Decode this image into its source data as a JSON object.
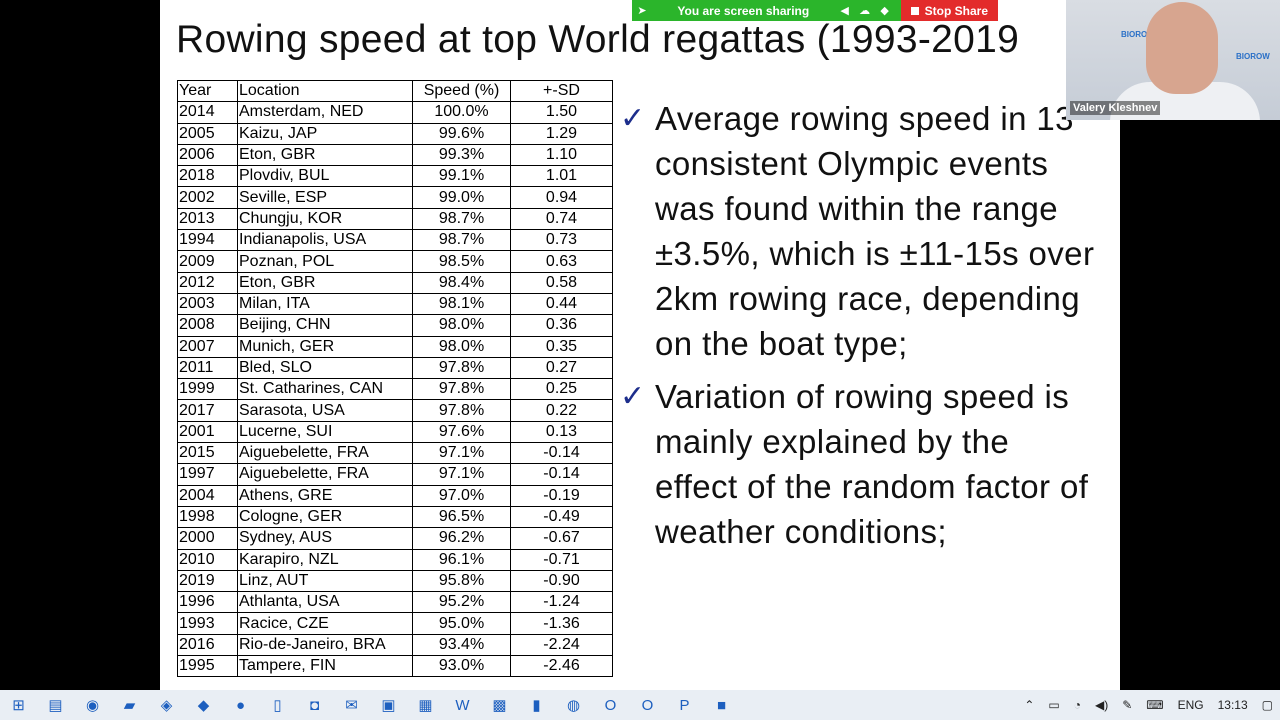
{
  "share_bar": {
    "status": "You are screen sharing",
    "stop_label": "Stop Share"
  },
  "slide": {
    "title": "Rowing speed at top World regattas (1993-2019",
    "table": {
      "headers": [
        "Year",
        "Location",
        "Speed (%)",
        "+-SD"
      ],
      "rows": [
        [
          "2014",
          "Amsterdam, NED",
          "100.0%",
          "1.50"
        ],
        [
          "2005",
          "Kaizu, JAP",
          "99.6%",
          "1.29"
        ],
        [
          "2006",
          "Eton, GBR",
          "99.3%",
          "1.10"
        ],
        [
          "2018",
          "Plovdiv, BUL",
          "99.1%",
          "1.01"
        ],
        [
          "2002",
          "Seville, ESP",
          "99.0%",
          "0.94"
        ],
        [
          "2013",
          "Chungju, KOR",
          "98.7%",
          "0.74"
        ],
        [
          "1994",
          "Indianapolis, USA",
          "98.7%",
          "0.73"
        ],
        [
          "2009",
          "Poznan, POL",
          "98.5%",
          "0.63"
        ],
        [
          "2012",
          "Eton, GBR",
          "98.4%",
          "0.58"
        ],
        [
          "2003",
          "Milan, ITA",
          "98.1%",
          "0.44"
        ],
        [
          "2008",
          "Beijing, CHN",
          "98.0%",
          "0.36"
        ],
        [
          "2007",
          "Munich, GER",
          "98.0%",
          "0.35"
        ],
        [
          "2011",
          "Bled, SLO",
          "97.8%",
          "0.27"
        ],
        [
          "1999",
          "St. Catharines, CAN",
          "97.8%",
          "0.25"
        ],
        [
          "2017",
          "Sarasota, USA",
          "97.8%",
          "0.22"
        ],
        [
          "2001",
          "Lucerne, SUI",
          "97.6%",
          "0.13"
        ],
        [
          "2015",
          "Aiguebelette, FRA",
          "97.1%",
          "-0.14"
        ],
        [
          "1997",
          "Aiguebelette, FRA",
          "97.1%",
          "-0.14"
        ],
        [
          "2004",
          "Athens, GRE",
          "97.0%",
          "-0.19"
        ],
        [
          "1998",
          "Cologne, GER",
          "96.5%",
          "-0.49"
        ],
        [
          "2000",
          "Sydney, AUS",
          "96.2%",
          "-0.67"
        ],
        [
          "2010",
          "Karapiro, NZL",
          "96.1%",
          "-0.71"
        ],
        [
          "2019",
          "Linz, AUT",
          "95.8%",
          "-0.90"
        ],
        [
          "1996",
          "Athlanta, USA",
          "95.2%",
          "-1.24"
        ],
        [
          "1993",
          "Racice, CZE",
          "95.0%",
          "-1.36"
        ],
        [
          "2016",
          "Rio-de-Janeiro, BRA",
          "93.4%",
          "-2.24"
        ],
        [
          "1995",
          "Tampere, FIN",
          "93.0%",
          "-2.46"
        ]
      ]
    },
    "bullets": [
      {
        "icon": "check-icon",
        "text": "Average rowing speed in 13 consistent Olympic events was found within the range ±3.5%, which is ±11-15s over 2km rowing race, depending on the boat type;"
      },
      {
        "icon": "check-icon",
        "text": "Variation of rowing speed is mainly explained by the effect of the random factor of weather conditions;"
      }
    ]
  },
  "webcam": {
    "name": "Valery Kleshnev",
    "brand": "BIOROW"
  },
  "taskbar": {
    "language": "ENG",
    "time": "13:13"
  },
  "colors": {
    "share_green": "#2bb52b",
    "stop_red": "#e32b2b",
    "check_blue": "#1d2e8c"
  }
}
